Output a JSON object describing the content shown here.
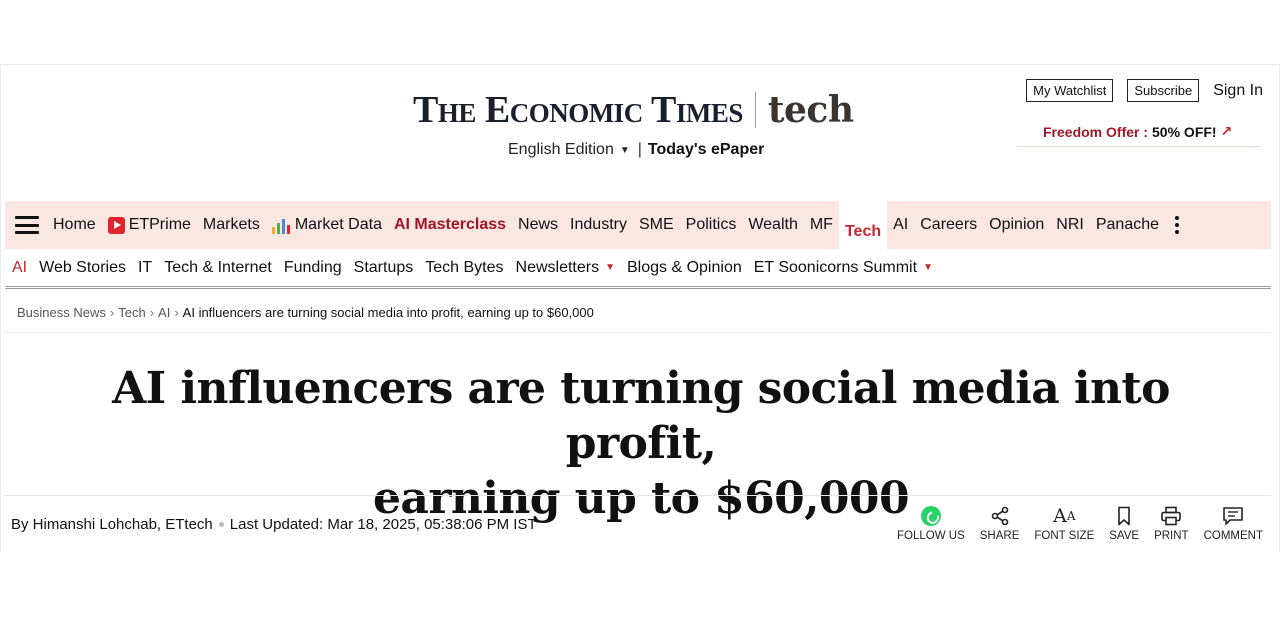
{
  "masthead": {
    "logo_text": "The Economic Times",
    "logo_section": "tech",
    "edition_label": "English Edition",
    "pipe": "|",
    "epaper_label": "Today's ePaper",
    "watchlist_label": "My Watchlist",
    "subscribe_label": "Subscribe",
    "signin_label": "Sign In",
    "offer_label": "Freedom Offer :",
    "offer_discount": "50% OFF!",
    "offer_arrow": "↗"
  },
  "main_nav": {
    "items": {
      "home": "Home",
      "etprime": "ETPrime",
      "markets": "Markets",
      "market_data": "Market Data",
      "ai_masterclass": "AI Masterclass",
      "news": "News",
      "industry": "Industry",
      "sme": "SME",
      "politics": "Politics",
      "wealth": "Wealth",
      "mf": "MF",
      "tech": "Tech",
      "ai": "AI",
      "careers": "Careers",
      "opinion": "Opinion",
      "nri": "NRI",
      "panache": "Panache"
    }
  },
  "sub_nav": {
    "items": {
      "ai": "AI",
      "web_stories": "Web Stories",
      "it": "IT",
      "tech_internet": "Tech & Internet",
      "funding": "Funding",
      "startups": "Startups",
      "tech_bytes": "Tech Bytes",
      "newsletters": "Newsletters",
      "blogs_opinion": "Blogs & Opinion",
      "soonicorns": "ET Soonicorns Summit"
    }
  },
  "breadcrumb": {
    "sep": "›",
    "items": [
      "Business News",
      "Tech",
      "AI"
    ],
    "current": "AI influencers are turning social media into profit, earning up to $60,000"
  },
  "article": {
    "headline_line1": "AI influencers are turning social media into profit,",
    "headline_line2": "earning up to $60,000",
    "byline": "By Himanshi Lohchab, ETtech",
    "last_updated": "Last Updated: Mar 18, 2025, 05:38:06 PM IST"
  },
  "actions": {
    "follow": "FOLLOW US",
    "share": "SHARE",
    "font_size": "FONT SIZE",
    "save": "SAVE",
    "print": "PRINT",
    "comment": "COMMENT"
  },
  "colors": {
    "brand_red": "#c2262e",
    "masterclass_red": "#a0172a",
    "nav_bg": "#fbe7e2",
    "whatsapp_green": "#25d366"
  }
}
